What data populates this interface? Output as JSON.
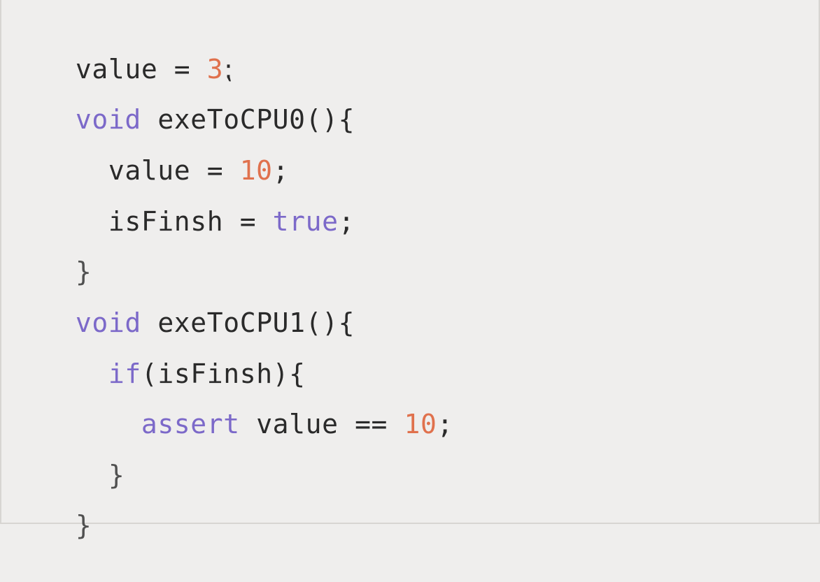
{
  "colors": {
    "background": "#efeeed",
    "text": "#2a2a2a",
    "keyword": "#7c69c9",
    "number": "#e0714d"
  },
  "code": {
    "line1": {
      "a": "value = ",
      "num": "3",
      "b": "⁏"
    },
    "line2": {
      "kw": "void",
      "a": " exeToCPU0(){"
    },
    "line3": {
      "a": "  value = ",
      "num": "10",
      "b": ";"
    },
    "line4": {
      "a": "  isFinsh = ",
      "kw": "true",
      "b": ";"
    },
    "line5": {
      "a": "}"
    },
    "line6": {
      "kw": "void",
      "a": " exeToCPU1(){"
    },
    "line7": {
      "indent": "  ",
      "kw": "if",
      "a": "(isFinsh){"
    },
    "line8": {
      "indent": "    ",
      "kw": "assert",
      "a": " value == ",
      "num": "10",
      "b": ";"
    },
    "line9": {
      "a": "  }"
    },
    "line10": {
      "a": "}"
    }
  }
}
